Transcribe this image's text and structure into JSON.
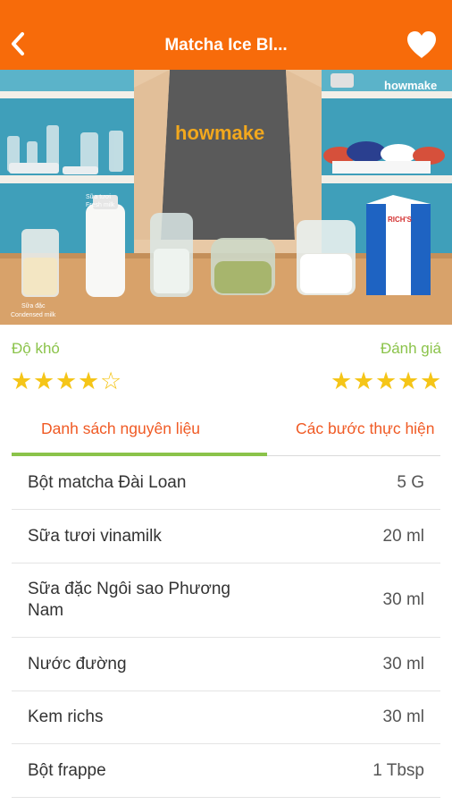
{
  "header": {
    "title": "Matcha Ice Bl...",
    "back_icon": "chevron-left-icon",
    "favorite_icon": "heart-icon",
    "bg_color": "#f76b0a"
  },
  "hero": {
    "watermark": "howmake",
    "apron_logo": "howmake",
    "fresh_milk_label": "Sữa tươi",
    "fresh_milk_label_en": "Fresh milk",
    "condensed_milk_label": "Sữa đặc",
    "condensed_milk_label_en": "Condensed milk",
    "carton_brand": "RICH'S"
  },
  "info": {
    "difficulty_label": "Độ khó",
    "difficulty_stars": 4,
    "rating_label": "Đánh giá",
    "rating_stars": 5,
    "max_stars": 5,
    "star_color": "#f5c518",
    "label_color": "#8bc34a"
  },
  "tabs": [
    {
      "label": "Danh sách nguyên liệu",
      "active": true
    },
    {
      "label": "Các bước thực hiện",
      "active": false
    }
  ],
  "ingredients": [
    {
      "name": "Bột matcha Đài Loan",
      "qty": "5 G"
    },
    {
      "name": "Sữa tươi vinamilk",
      "qty": "20 ml"
    },
    {
      "name": "Sữa đặc Ngôi sao Phương Nam",
      "qty": "30 ml"
    },
    {
      "name": "Nước đường",
      "qty": "30 ml"
    },
    {
      "name": "Kem richs",
      "qty": "30 ml"
    },
    {
      "name": "Bột frappe",
      "qty": "1 Tbsp"
    }
  ]
}
